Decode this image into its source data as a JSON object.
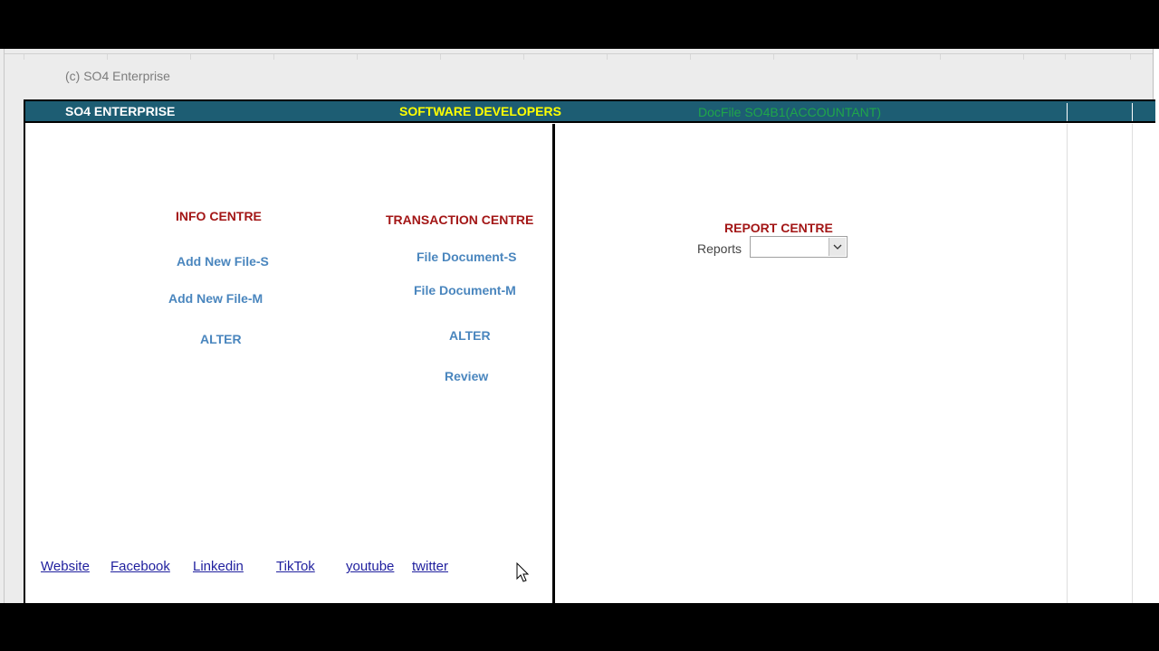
{
  "copyright": "(c) SO4 Enterprise",
  "header": {
    "company": "SO4 ENTERPRISE",
    "tagline": "SOFTWARE DEVELOPERS",
    "docfile": "DocFile SO4B1(ACCOUNTANT)"
  },
  "colors": {
    "header_band": "#1d5d73",
    "title_red": "#a31616",
    "action_blue": "#4a86be",
    "link_blue": "#1f1f9e",
    "tagline_yellow": "#ffff00",
    "docfile_green": "#1fa64a"
  },
  "info_centre": {
    "title": "INFO CENTRE",
    "add_single": "Add New File-S",
    "add_multi": "Add New File-M",
    "alter": "ALTER"
  },
  "transaction_centre": {
    "title": "TRANSACTION CENTRE",
    "doc_single": "File Document-S",
    "doc_multi": "File Document-M",
    "alter": "ALTER",
    "review": "Review"
  },
  "report_centre": {
    "title": "REPORT CENTRE",
    "reports_label": "Reports",
    "reports_value": ""
  },
  "social_links": {
    "website": "Website",
    "facebook": "Facebook",
    "linkedin": "Linkedin",
    "tiktok": "TikTok",
    "youtube": "youtube",
    "twitter": "twitter"
  },
  "icons": {
    "dropdown": "chevron-down-icon",
    "cursor": "mouse-pointer-icon"
  }
}
